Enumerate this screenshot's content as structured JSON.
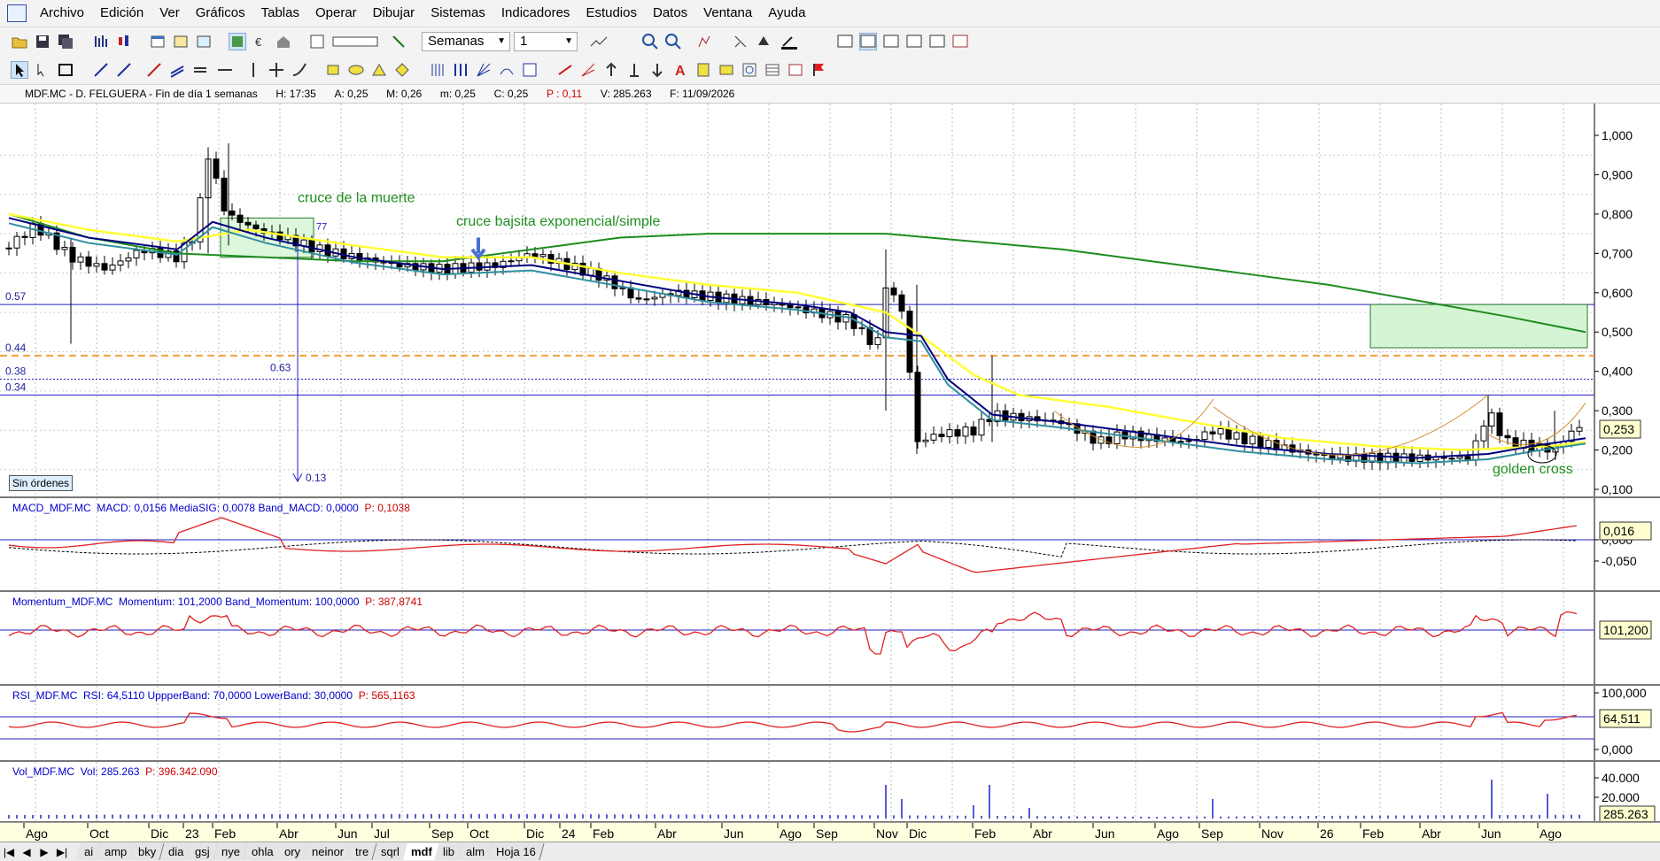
{
  "menu": [
    "Archivo",
    "Edición",
    "Ver",
    "Gráficos",
    "Tablas",
    "Operar",
    "Dibujar",
    "Sistemas",
    "Indicadores",
    "Estudios",
    "Datos",
    "Ventana",
    "Ayuda"
  ],
  "toolbar": {
    "period": "Semanas",
    "multiplier": "1"
  },
  "info": {
    "symbol": "MDF.MC - D. FELGUERA - Fin de día 1 semanas",
    "h": "H: 17:35",
    "a": "A: 0,25",
    "m": "M: 0,26",
    "m2": "m: 0,25",
    "c": "C: 0,25",
    "p": "P : 0,11",
    "v": "V: 285.263",
    "f": "F: 11/09/2026"
  },
  "main": {
    "y_ticks": [
      "1,000",
      "0,900",
      "0,800",
      "0,700",
      "0,600",
      "0,500",
      "0,400",
      "0,300",
      "0,200",
      "0,100"
    ],
    "current_value": "0,253",
    "hline_labels": [
      "0.57",
      "0.44",
      "0.38",
      "0.34"
    ],
    "measure_labels": [
      "0.63",
      "0.13"
    ],
    "annotations": {
      "death_cross": "cruce de la muerte",
      "bear_cross": "cruce bajsita exponencial/simple",
      "golden_cross": "golden cross",
      "small": "77"
    },
    "orders_button": "Sin órdenes"
  },
  "macd": {
    "label": "MACD_MDF.MC",
    "values": "MACD: 0,0156  MediaSIG: 0,0078  Band_MACD: 0,0000",
    "p": "P: 0,1038",
    "y_ticks": [
      "0,000",
      "-0,050"
    ],
    "current_value": "0,016"
  },
  "momentum": {
    "label": "Momentum_MDF.MC",
    "values": "Momentum: 101,2000  Band_Momentum: 100,0000",
    "p": "P: 387,8741",
    "current_value": "101,200"
  },
  "rsi": {
    "label": "RSI_MDF.MC",
    "values": "RSI: 64,5110  UppperBand: 70,0000  LowerBand: 30,0000",
    "p": "P: 565,1163",
    "y_ticks": [
      "100,000",
      "0,000"
    ],
    "current_value": "64,511"
  },
  "vol": {
    "label": "Vol_MDF.MC",
    "values": "Vol: 285.263",
    "p": "P: 396.342.090",
    "y_ticks": [
      "40.000",
      "20.000"
    ],
    "current_value": "285.263"
  },
  "time_axis": [
    "Ago",
    "Oct",
    "Dic",
    "23",
    "Feb",
    "Abr",
    "Jun",
    "Jul",
    "Sep",
    "Oct",
    "Dic",
    "24",
    "Feb",
    "Abr",
    "Jun",
    "Ago",
    "Sep",
    "Nov",
    "Dic",
    "Feb",
    "Abr",
    "Jun",
    "Ago",
    "Sep",
    "Nov",
    "26",
    "Feb",
    "Abr",
    "Jun",
    "Ago"
  ],
  "tabs": [
    "ai",
    "amp",
    "bky",
    "dia",
    "gsj",
    "nye",
    "ohla",
    "ory",
    "neinor",
    "tre",
    "sqrl",
    "mdf",
    "lib",
    "alm",
    "Hoja 16"
  ],
  "active_tab": "mdf",
  "colors": {
    "sma_long": "#1e8c1e",
    "sma_mid": "#ffff33",
    "ema": "#000080",
    "ema2": "#2f8fa0",
    "indicator": "#e02020",
    "band": "#2020c0"
  }
}
